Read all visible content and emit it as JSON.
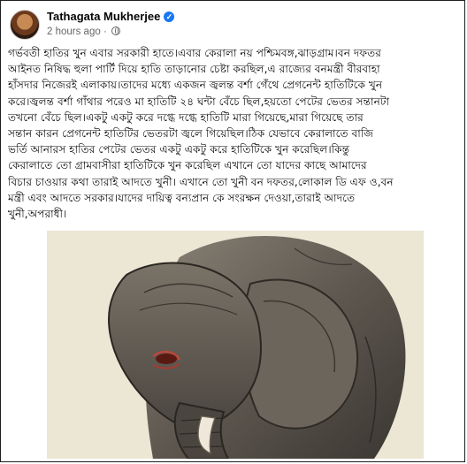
{
  "post": {
    "author": "Tathagata Mukherjee",
    "time": "2 hours ago",
    "separator": "·",
    "lines": [
      "গর্ভবতী হাতির খুন এবার সরকারী হাতে।এবার কেরালা নয় পশ্চিমবঙ্গ,ঝাড়গ্রাম।বন দফতর",
      "আইনত নিষিদ্ধ হুলা পার্টি দিয়ে হাতি তাড়ানোর চেষ্টা করছিল,এ রাজ্যের বনমন্ত্রী বীরবাহা",
      "হাঁসদার নিজেরই এলাকায়।তাদের মধ্যে একজন জ্বলন্ত বর্শা গেঁথে প্রেগনেন্ট হাতিটিকে খুন",
      "করে।জ্বলন্ত বর্শা গাঁথার পরেও মা হাতিটি ২৪ ঘন্টা বেঁচে ছিল,হয়তো পেটের ভেতর সন্তানটা",
      "তখনো বেঁচে ছিল।একটু একটু করে দগ্ধে দগ্ধে হাতিটি মারা গিয়েছে,মারা গিয়েছে তার",
      "সন্তান কারন প্রেগনেন্ট হাতিটির ভেতরটা জ্বলে গিয়েছিল।ঠিক যেভাবে কেরালাতে বাজি",
      "ভর্তি আনারস হাতির পেটের ভেতর একটু একটু করে হাতিটিকে খুন করেছিল।কিন্তু",
      "কেরালাতে তো গ্রামবাসীরা হাতিটিকে খুন করেছিল এখানে তো যাদের কাছে আমাদের",
      "বিচার চাওয়ার কথা তারাই আদতে খুনী। এখানে তো খুনী বন দফতর,লোকাল ডি এফ ও,বন",
      "মন্ত্রী এবং আদতে সরকার।যাদের দায়িত্ব বন্যপ্রান কে সংরক্ষন দেওয়া,তারাই আদতে",
      "খুনী,অপরাধী।"
    ]
  },
  "colors": {
    "accent": "#1877f2",
    "secondary_text": "#65676b"
  },
  "icons": {
    "verified": "verified-badge-icon",
    "privacy": "globe-icon"
  }
}
